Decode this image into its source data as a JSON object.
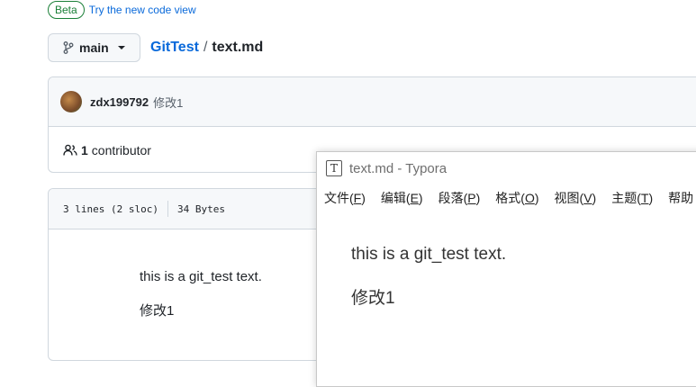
{
  "beta": {
    "badge": "Beta",
    "link": "Try the new code view"
  },
  "branch": {
    "label": "main"
  },
  "breadcrumb": {
    "repo": "GitTest",
    "separator": "/",
    "file": "text.md"
  },
  "commit": {
    "author": "zdx199792",
    "message": "修改1"
  },
  "contributors": {
    "count": "1",
    "label": "contributor"
  },
  "file_info": {
    "lines": "3 lines (2 sloc)",
    "size": "34 Bytes"
  },
  "file_content": {
    "line1": "this is a git_test text.",
    "line2": "修改1"
  },
  "typora": {
    "title": "text.md - Typora",
    "menu": [
      {
        "label": "文件",
        "key": "F"
      },
      {
        "label": "编辑",
        "key": "E"
      },
      {
        "label": "段落",
        "key": "P"
      },
      {
        "label": "格式",
        "key": "O"
      },
      {
        "label": "视图",
        "key": "V"
      },
      {
        "label": "主题",
        "key": "T"
      },
      {
        "label": "帮助",
        "key": ""
      }
    ],
    "doc_line1": "this is a git_test text.",
    "doc_line2": "修改1"
  },
  "colors": {
    "link": "#0969da",
    "beta": "#1a7f37",
    "border": "#d0d7de"
  }
}
